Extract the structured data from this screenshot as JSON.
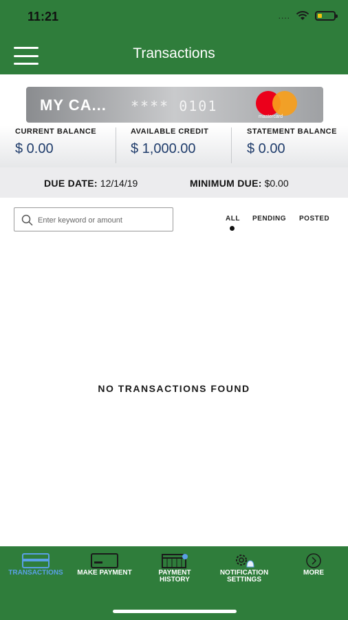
{
  "status_bar": {
    "time": "11:21",
    "signal": "...."
  },
  "header": {
    "title": "Transactions"
  },
  "card": {
    "name": "MY CA...",
    "masked_number": "**** 0101",
    "brand": "mastercard"
  },
  "balances": [
    {
      "label": "CURRENT BALANCE",
      "value": "$ 0.00"
    },
    {
      "label": "AVAILABLE CREDIT",
      "value": "$ 1,000.00"
    },
    {
      "label": "STATEMENT BALANCE",
      "value": "$ 0.00"
    }
  ],
  "due": {
    "due_date_label": "DUE DATE:",
    "due_date_value": "12/14/19",
    "min_due_label": "MINIMUM DUE:",
    "min_due_value": "$0.00"
  },
  "search": {
    "placeholder": "Enter keyword or amount",
    "value": ""
  },
  "filters": [
    {
      "label": "ALL",
      "selected": true
    },
    {
      "label": "PENDING",
      "selected": false
    },
    {
      "label": "POSTED",
      "selected": false
    }
  ],
  "empty_message": "NO TRANSACTIONS FOUND",
  "tabbar": {
    "tabs": [
      {
        "label": "TRANSACTIONS",
        "icon": "credit-card-icon",
        "active": true
      },
      {
        "label": "MAKE PAYMENT",
        "icon": "payment-card-icon",
        "active": false
      },
      {
        "label": "PAYMENT\nHISTORY",
        "icon": "calendar-icon",
        "active": false
      },
      {
        "label": "NOTIFICATION\nSETTINGS",
        "icon": "gear-bell-icon",
        "active": false
      },
      {
        "label": "MORE",
        "icon": "chevron-circle-icon",
        "active": false
      }
    ]
  },
  "colors": {
    "brand_green": "#2f7d3b",
    "balance_blue": "#1f3c6b",
    "active_tab": "#5aa0e6"
  }
}
